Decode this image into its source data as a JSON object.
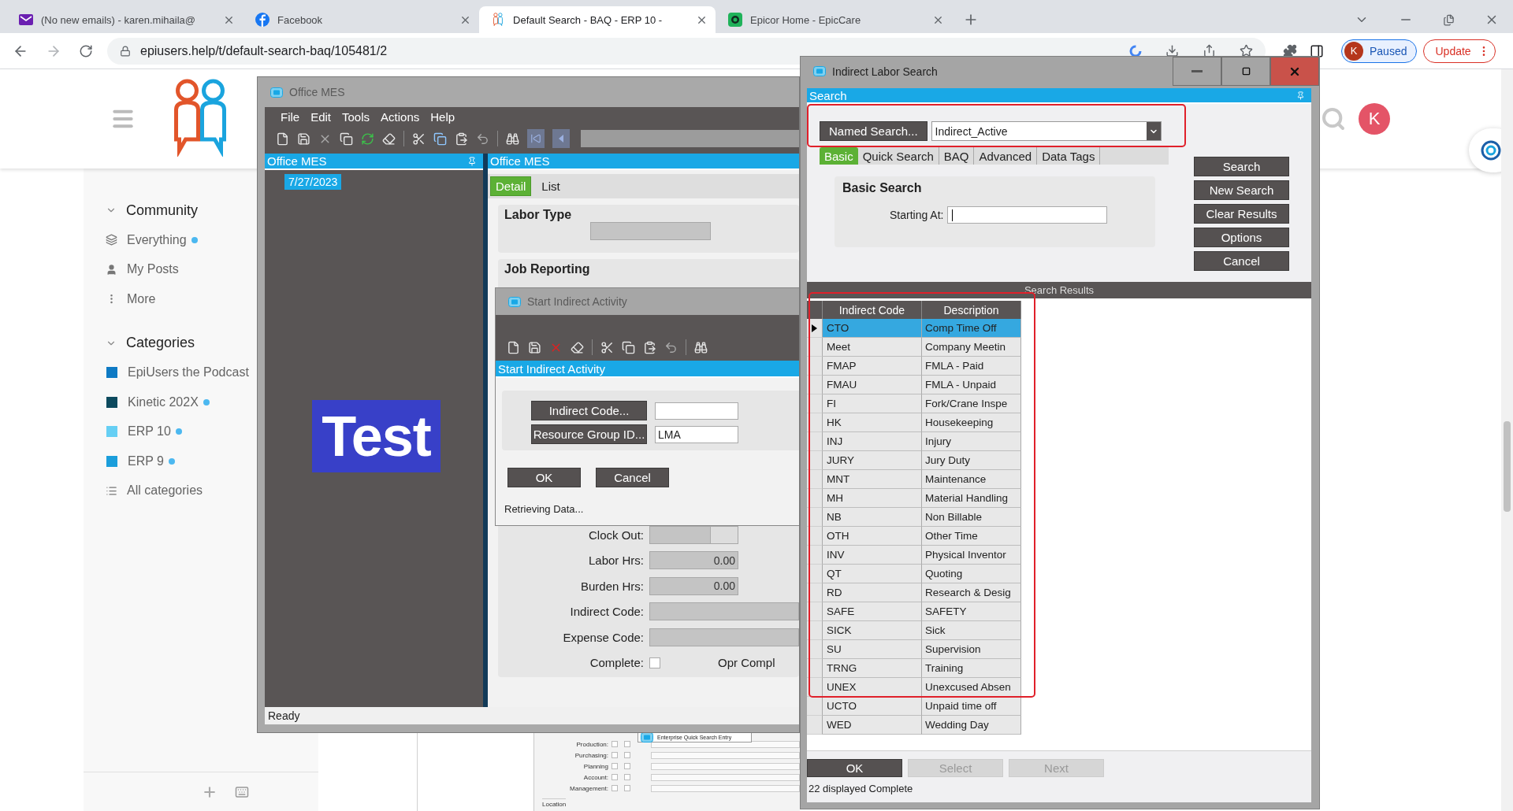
{
  "browser": {
    "tabs": [
      {
        "title": "(No new emails) - karen.mihaila@",
        "kind": "mail",
        "selected": false
      },
      {
        "title": "Facebook",
        "kind": "facebook",
        "selected": false
      },
      {
        "title": "Default Search - BAQ - ERP 10 -",
        "kind": "forum",
        "selected": true
      },
      {
        "title": "Epicor Home - EpicCare",
        "kind": "epiccare",
        "selected": false
      }
    ],
    "url": "epiusers.help/t/default-search-baq/105481/2",
    "profile": {
      "initial": "K",
      "status": "Paused"
    },
    "update_label": "Update"
  },
  "site": {
    "avatar_initial": "K",
    "sidebar": [
      {
        "title": "Community",
        "expanded": true,
        "items": [
          {
            "label": "Everything",
            "kind": "layers",
            "unread": true
          },
          {
            "label": "My Posts",
            "kind": "user",
            "unread": false
          },
          {
            "label": "More",
            "kind": "more",
            "unread": false
          }
        ]
      },
      {
        "title": "Categories",
        "expanded": true,
        "items": [
          {
            "label": "EpiUsers the Podcast",
            "kind": "category",
            "color": "#0e7ac4",
            "unread": false
          },
          {
            "label": "Kinetic 202X",
            "kind": "category",
            "color": "#0c4a5e",
            "unread": true
          },
          {
            "label": "ERP 10",
            "kind": "category",
            "color": "#66cff4",
            "unread": true
          },
          {
            "label": "ERP 9",
            "kind": "category",
            "color": "#1b9edb",
            "unread": true
          },
          {
            "label": "All categories",
            "kind": "list",
            "unread": false
          }
        ]
      }
    ],
    "embedded_form": {
      "tooltip": "Enterprise Quick Search Entry",
      "rows": [
        {
          "label": "Production:",
          "checked": [
            false,
            false
          ]
        },
        {
          "label": "Purchasing:",
          "checked": [
            false,
            false
          ]
        },
        {
          "label": "Planning",
          "checked": [
            false,
            false
          ]
        },
        {
          "label": "Account:",
          "checked": [
            false,
            false
          ]
        },
        {
          "label": "Management:",
          "checked": [
            false,
            false
          ]
        }
      ],
      "section": "Location"
    }
  },
  "office_mes": {
    "title": "Office MES",
    "menu": [
      "File",
      "Edit",
      "Tools",
      "Actions",
      "Help"
    ],
    "tree_header": "Office MES",
    "tree_date": "7/27/2023",
    "logo_text": "Test",
    "panel_header": "Office MES",
    "tabs": [
      {
        "label": "Detail",
        "selected": true
      },
      {
        "label": "List",
        "selected": false
      }
    ],
    "groups": [
      "Labor Type",
      "Job Reporting"
    ],
    "fields": [
      {
        "label": "Clock Out:",
        "kind": "spinner"
      },
      {
        "label": "Labor Hrs:",
        "kind": "number",
        "value": "0.00"
      },
      {
        "label": "Burden Hrs:",
        "kind": "number",
        "value": "0.00"
      },
      {
        "label": "Indirect Code:",
        "kind": "text"
      },
      {
        "label": "Expense Code:",
        "kind": "text"
      },
      {
        "label": "Complete:",
        "kind": "checkbox",
        "checked": false,
        "side_label": "Opr Compl"
      }
    ],
    "status": "Ready"
  },
  "start_indirect": {
    "title": "Start Indirect Activity",
    "header": "Start Indirect Activity",
    "fields": [
      {
        "button": "Indirect Code..."
      },
      {
        "button": "Resource Group ID...",
        "value": "LMA"
      }
    ],
    "buttons": [
      "OK",
      "Cancel"
    ],
    "status": "Retrieving Data..."
  },
  "search_window": {
    "title": "Indirect Labor Search",
    "section": "Search",
    "named_search_button": "Named Search...",
    "named_search_value": "Indirect_Active",
    "tabs": [
      {
        "label": "Basic",
        "selected": true
      },
      {
        "label": "Quick Search",
        "selected": false
      },
      {
        "label": "BAQ",
        "selected": false
      },
      {
        "label": "Advanced",
        "selected": false
      },
      {
        "label": "Data Tags",
        "selected": false
      }
    ],
    "group_title": "Basic Search",
    "starting_at_label": "Starting At:",
    "actions": [
      "Search",
      "New Search",
      "Clear Results",
      "Options",
      "Cancel"
    ],
    "results_title": "Search Results",
    "columns": [
      "Indirect Code",
      "Description"
    ],
    "rows": [
      {
        "code": "CTO",
        "description": "Comp Time Off",
        "selected": true
      },
      {
        "code": "Meet",
        "description": "Company Meetin",
        "selected": false
      },
      {
        "code": "FMAP",
        "description": "FMLA - Paid",
        "selected": false
      },
      {
        "code": "FMAU",
        "description": "FMLA - Unpaid",
        "selected": false
      },
      {
        "code": "FI",
        "description": "Fork/Crane Inspe",
        "selected": false
      },
      {
        "code": "HK",
        "description": "Housekeeping",
        "selected": false
      },
      {
        "code": "INJ",
        "description": "Injury",
        "selected": false
      },
      {
        "code": "JURY",
        "description": "Jury Duty",
        "selected": false
      },
      {
        "code": "MNT",
        "description": "Maintenance",
        "selected": false
      },
      {
        "code": "MH",
        "description": "Material Handling",
        "selected": false
      },
      {
        "code": "NB",
        "description": "Non Billable",
        "selected": false
      },
      {
        "code": "OTH",
        "description": "Other Time",
        "selected": false
      },
      {
        "code": "INV",
        "description": "Physical Inventor",
        "selected": false
      },
      {
        "code": "QT",
        "description": "Quoting",
        "selected": false
      },
      {
        "code": "RD",
        "description": "Research & Desig",
        "selected": false
      },
      {
        "code": "SAFE",
        "description": "SAFETY",
        "selected": false
      },
      {
        "code": "SICK",
        "description": "Sick",
        "selected": false
      },
      {
        "code": "SU",
        "description": "Supervision",
        "selected": false
      },
      {
        "code": "TRNG",
        "description": "Training",
        "selected": false
      },
      {
        "code": "UNEX",
        "description": "Unexcused Absen",
        "selected": false
      },
      {
        "code": "UCTO",
        "description": "Unpaid time off",
        "selected": false
      },
      {
        "code": "WED",
        "description": "Wedding Day",
        "selected": false
      }
    ],
    "footer_buttons": [
      {
        "label": "OK",
        "disabled": false
      },
      {
        "label": "Select",
        "disabled": true
      },
      {
        "label": "Next",
        "disabled": true
      }
    ],
    "status": "22 displayed Complete"
  }
}
